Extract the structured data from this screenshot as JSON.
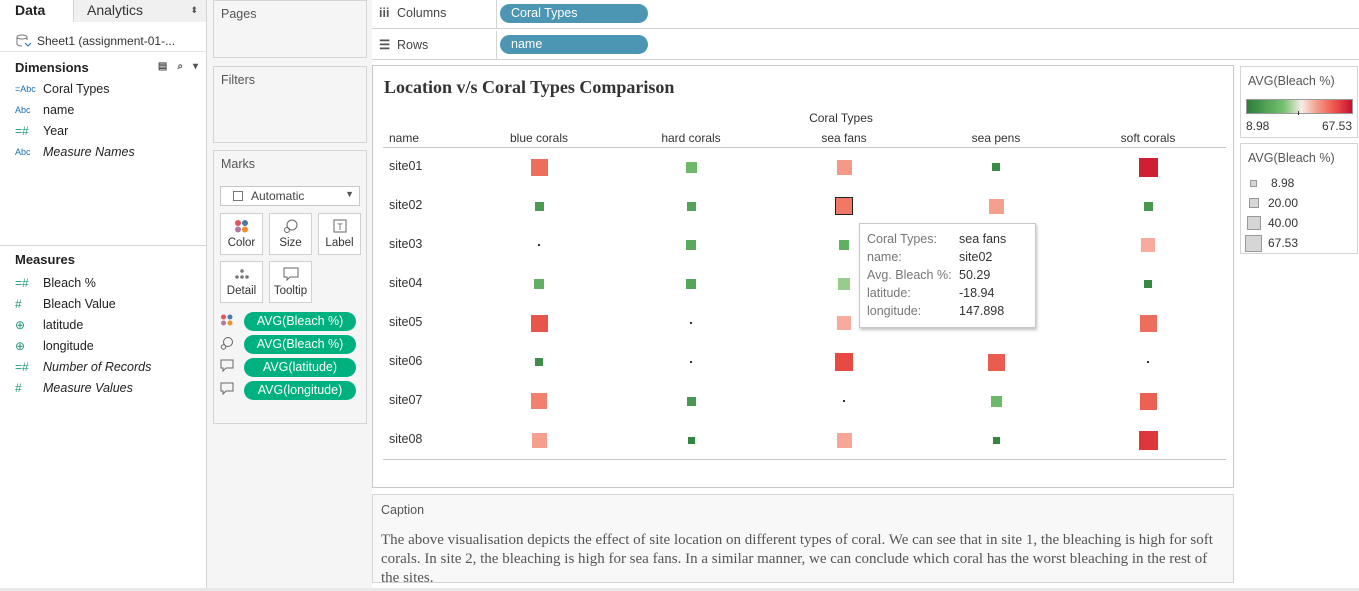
{
  "left_pane": {
    "tab_data": "Data",
    "tab_analytics": "Analytics",
    "tab_arrows": "⬍",
    "data_source": "Sheet1 (assignment-01-...",
    "dimensions_title": "Dimensions",
    "dimensions": [
      {
        "type": "=Abc",
        "name": "Coral Types",
        "italic": false
      },
      {
        "type": "Abc",
        "name": "name",
        "italic": false
      },
      {
        "type": "=#",
        "name": "Year",
        "italic": false
      },
      {
        "type": "Abc",
        "name": "Measure Names",
        "italic": true
      }
    ],
    "measures_title": "Measures",
    "measures": [
      {
        "type": "=#",
        "name": "Bleach %",
        "italic": false
      },
      {
        "type": "#",
        "name": "Bleach Value",
        "italic": false
      },
      {
        "type": "⊕",
        "name": "latitude",
        "italic": false
      },
      {
        "type": "⊕",
        "name": "longitude",
        "italic": false
      },
      {
        "type": "=#",
        "name": "Number of Records",
        "italic": true
      },
      {
        "type": "#",
        "name": "Measure Values",
        "italic": true
      }
    ]
  },
  "cards": {
    "pages": "Pages",
    "filters": "Filters",
    "marks": "Marks",
    "mark_type": "Automatic",
    "buttons": {
      "color": "Color",
      "size": "Size",
      "label": "Label",
      "detail": "Detail",
      "tooltip": "Tooltip"
    },
    "pills": [
      "AVG(Bleach %)",
      "AVG(Bleach %)",
      "AVG(latitude)",
      "AVG(longitude)"
    ]
  },
  "shelves": {
    "columns_label": "Columns",
    "columns_pill": "Coral Types",
    "rows_label": "Rows",
    "rows_pill": "name"
  },
  "view": {
    "title": "Location v/s Coral Types Comparison",
    "column_header_title": "Coral Types",
    "row_header_title": "name",
    "coral_types": [
      "blue corals",
      "hard corals",
      "sea fans",
      "sea pens",
      "soft corals"
    ],
    "sites": [
      "site01",
      "site02",
      "site03",
      "site04",
      "site05",
      "site06",
      "site07",
      "site08"
    ]
  },
  "chart_data": {
    "type": "heatmap",
    "title": "Location v/s Coral Types Comparison",
    "xlabel": "Coral Types",
    "ylabel": "name",
    "categories": [
      "blue corals",
      "hard corals",
      "sea fans",
      "sea pens",
      "soft corals"
    ],
    "rows": [
      "site01",
      "site02",
      "site03",
      "site04",
      "site05",
      "site06",
      "site07",
      "site08"
    ],
    "measure": "AVG(Bleach %)",
    "value_range": [
      8.98,
      67.53
    ],
    "values": [
      [
        52,
        27,
        45,
        13,
        65
      ],
      [
        18,
        20,
        50.29,
        44,
        17
      ],
      [
        0.5,
        22,
        24,
        0,
        42
      ],
      [
        24,
        21,
        33,
        0,
        12
      ],
      [
        56,
        0.1,
        42,
        0,
        52
      ],
      [
        14,
        0.1,
        58,
        55,
        0.1
      ],
      [
        49,
        17,
        0.1,
        27,
        54
      ],
      [
        44,
        11,
        43,
        11,
        61
      ]
    ],
    "selected_cell": {
      "row": "site02",
      "column": "sea fans"
    }
  },
  "tooltip": {
    "rows": [
      {
        "k": "Coral Types:",
        "v": "sea fans"
      },
      {
        "k": "name:",
        "v": "site02"
      },
      {
        "k": "Avg. Bleach %:",
        "v": "50.29"
      },
      {
        "k": "latitude:",
        "v": "-18.94"
      },
      {
        "k": "longitude:",
        "v": "147.898"
      }
    ]
  },
  "legend_color": {
    "title": "AVG(Bleach %)",
    "min": "8.98",
    "max": "67.53"
  },
  "legend_size": {
    "title": "AVG(Bleach %)",
    "items": [
      "8.98",
      "20.00",
      "40.00",
      "67.53"
    ]
  },
  "caption": {
    "title": "Caption",
    "text": "The above visualisation depicts the effect of site location on different types of coral. We can see that in site 1, the bleaching is high for soft corals. In site 2, the bleaching is high for sea fans. In a similar manner, we can conclude which coral has the worst bleaching in the rest of the sites."
  }
}
